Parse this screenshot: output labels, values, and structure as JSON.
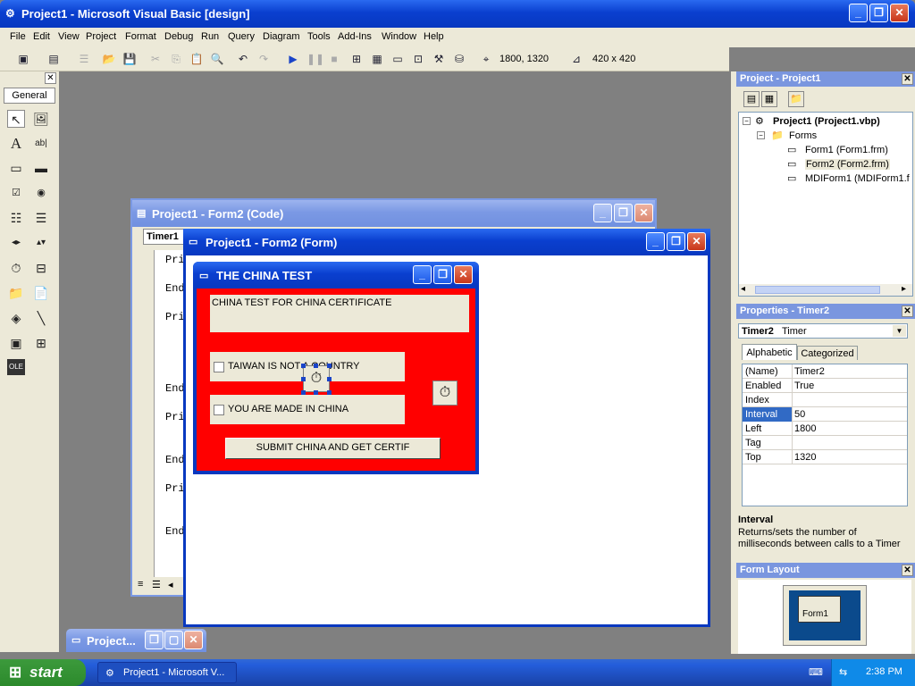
{
  "window": {
    "title": "Project1 - Microsoft Visual Basic [design]"
  },
  "menu": [
    "File",
    "Edit",
    "View",
    "Project",
    "Format",
    "Debug",
    "Run",
    "Query",
    "Diagram",
    "Tools",
    "Add-Ins",
    "Window",
    "Help"
  ],
  "toolbar": {
    "position": "1800, 1320",
    "size": "420 x 420"
  },
  "toolbox": {
    "title": "General"
  },
  "code_window": {
    "title": "Project1 - Form2 (Code)",
    "object_combo": "Timer1",
    "lines": [
      "Pri",
      "End",
      "Pri",
      "End",
      "Pri",
      "End",
      "Pri",
      "End"
    ]
  },
  "form_designer": {
    "title": "Project1 - Form2 (Form)"
  },
  "china_form": {
    "title": "THE CHINA TEST",
    "label": "CHINA TEST FOR CHINA CERTIFICATE",
    "check1": "TAIWAN IS NOT A COUNTRY",
    "check2": "YOU ARE MADE IN CHINA",
    "submit": "SUBMIT CHINA AND GET CERTIF",
    "bg_color": "#ff0000"
  },
  "minimized_window": {
    "title": "Project..."
  },
  "project_pane": {
    "title": "Project - Project1",
    "root": "Project1 (Project1.vbp)",
    "folder": "Forms",
    "items": [
      "Form1 (Form1.frm)",
      "Form2 (Form2.frm)",
      "MDIForm1 (MDIForm1.f"
    ]
  },
  "properties_pane": {
    "title": "Properties - Timer2",
    "object": "Timer2",
    "object_type": "Timer",
    "tabs": [
      "Alphabetic",
      "Categorized"
    ],
    "rows": [
      {
        "k": "(Name)",
        "v": "Timer2"
      },
      {
        "k": "Enabled",
        "v": "True"
      },
      {
        "k": "Index",
        "v": ""
      },
      {
        "k": "Interval",
        "v": "50"
      },
      {
        "k": "Left",
        "v": "1800"
      },
      {
        "k": "Tag",
        "v": ""
      },
      {
        "k": "Top",
        "v": "1320"
      }
    ],
    "desc_title": "Interval",
    "desc_text": "Returns/sets the number of milliseconds between calls to a Timer"
  },
  "form_layout": {
    "title": "Form Layout",
    "form_label": "Form1"
  },
  "taskbar": {
    "start": "start",
    "task": "Project1 - Microsoft V...",
    "time": "2:38 PM"
  }
}
